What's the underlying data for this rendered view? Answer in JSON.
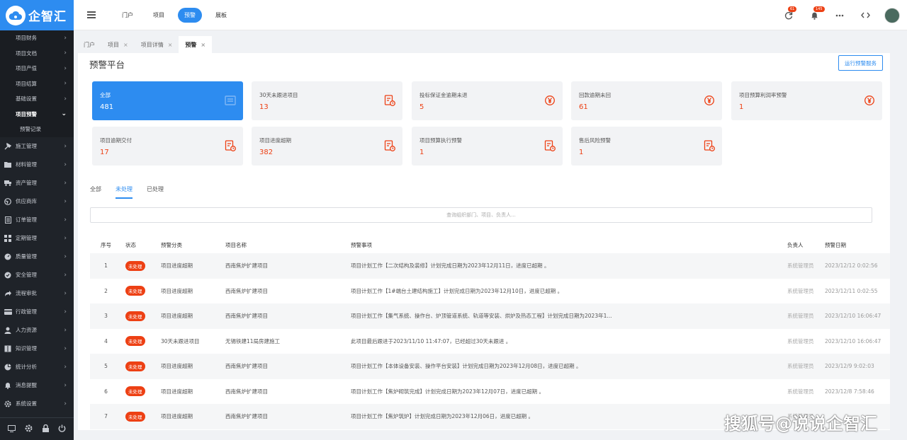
{
  "brand": {
    "name": "企智汇",
    "color": "#2d8cf0"
  },
  "sidebar": {
    "subitems": [
      {
        "label": "项目财务",
        "icon": "chevron-right-icon"
      },
      {
        "label": "项目文档",
        "icon": "chevron-right-icon"
      },
      {
        "label": "项目产值",
        "icon": "chevron-right-icon"
      },
      {
        "label": "项目结算",
        "icon": "chevron-right-icon"
      },
      {
        "label": "基础设置",
        "icon": "chevron-right-icon"
      },
      {
        "label": "项目预警",
        "icon": "chevron-down-icon"
      },
      {
        "label": "预警记录",
        "icon": ""
      }
    ],
    "items": [
      {
        "label": "施工管理",
        "icon": "hammer-icon"
      },
      {
        "label": "材料管理",
        "icon": "folder-icon"
      },
      {
        "label": "资产管理",
        "icon": "truck-icon"
      },
      {
        "label": "供应商库",
        "icon": "globe-icon"
      },
      {
        "label": "订单管理",
        "icon": "document-icon"
      },
      {
        "label": "定期管理",
        "icon": "grid-icon"
      },
      {
        "label": "质量管理",
        "icon": "gauge-icon"
      },
      {
        "label": "安全管理",
        "icon": "shield-icon"
      },
      {
        "label": "流程审批",
        "icon": "share-icon"
      },
      {
        "label": "行政管理",
        "icon": "card-icon"
      },
      {
        "label": "人力资源",
        "icon": "user-icon"
      },
      {
        "label": "知识管理",
        "icon": "book-icon"
      },
      {
        "label": "统计分析",
        "icon": "pie-chart-icon"
      },
      {
        "label": "消息提醒",
        "icon": "bell-icon"
      },
      {
        "label": "系统设置",
        "icon": "gear-icon"
      }
    ]
  },
  "topnav": [
    "门户",
    "项目",
    "预警",
    "展板"
  ],
  "topbar": {
    "badge1": "61",
    "badge2": "145"
  },
  "tabs": [
    {
      "label": "门户",
      "closable": false
    },
    {
      "label": "项目",
      "closable": true
    },
    {
      "label": "项目详情",
      "closable": true
    },
    {
      "label": "预警",
      "closable": true
    }
  ],
  "page": {
    "title": "预警平台",
    "run_button": "运行预警服务"
  },
  "cards": [
    {
      "label": "全部",
      "value": "481"
    },
    {
      "label": "30天未跟进项目",
      "value": "13"
    },
    {
      "label": "投标保证金逾期未退",
      "value": "5"
    },
    {
      "label": "回款逾期未回",
      "value": "61"
    },
    {
      "label": "项目预算利润率预警",
      "value": "1"
    },
    {
      "label": "项目逾期交付",
      "value": "17"
    },
    {
      "label": "项目进度超期",
      "value": "382"
    },
    {
      "label": "项目预算执行预警",
      "value": "1"
    },
    {
      "label": "售后风险预警",
      "value": "1"
    }
  ],
  "subtabs": [
    "全部",
    "未处理",
    "已处理"
  ],
  "search": {
    "placeholder": "查询组织部门、项目、负责人..."
  },
  "table": {
    "headers": [
      "序号",
      "状态",
      "预警分类",
      "项目名称",
      "预警事项",
      "负责人",
      "预警日期"
    ],
    "rows": [
      [
        "1",
        "未处理",
        "项目进度超期",
        "西南焦炉扩建项目",
        "项目计划工作【二次结构及装修】计划完成日期为2023年12月11日，进度已超期 。",
        "系统管理员",
        "2023/12/12 0:02:56"
      ],
      [
        "2",
        "未处理",
        "项目进度超期",
        "西南焦炉扩建项目",
        "项目计划工作【1#端台土建结构施工】计划完成日期为2023年12月10日，进度已超期 。",
        "系统管理员",
        "2023/12/11 0:02:55"
      ],
      [
        "3",
        "未处理",
        "项目进度超期",
        "西南焦炉扩建项目",
        "项目计划工作【集气系统、操作台、炉顶管道系统、轨道等安装、烘炉及热态工程】计划完成日期为2023年1...",
        "系统管理员",
        "2023/12/10 16:06:47"
      ],
      [
        "4",
        "未处理",
        "30天未跟进项目",
        "无锡铁建11局房建施工",
        "此项目最后跟进于2023/11/10 11:47:07，已经超过30天未跟进 。",
        "系统管理员",
        "2023/12/10 16:06:47"
      ],
      [
        "5",
        "未处理",
        "项目进度超期",
        "西南焦炉扩建项目",
        "项目计划工作【本体设备安装、操作平台安装】计划完成日期为2023年12月08日，进度已超期 。",
        "系统管理员",
        "2023/12/9 9:02:03"
      ],
      [
        "6",
        "未处理",
        "项目进度超期",
        "西南焦炉扩建项目",
        "项目计划工作【焦炉砌筑完成】计划完成日期为2023年12月07日，进度已超期 。",
        "系统管理员",
        "2023/12/8 7:58:46"
      ],
      [
        "7",
        "未处理",
        "项目进度超期",
        "西南焦炉扩建项目",
        "项目计划工作【焦炉筑炉】计划完成日期为2023年12月06日，进度已超期 。",
        "系统管理员",
        ""
      ]
    ]
  },
  "watermark": "搜狐号@说说企智汇"
}
